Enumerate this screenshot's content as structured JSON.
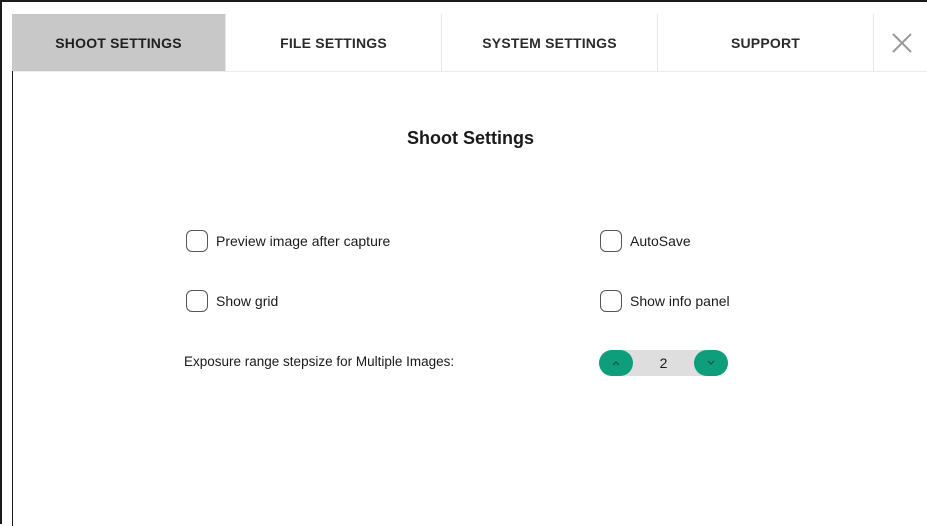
{
  "tabs": [
    {
      "label": "SHOOT SETTINGS",
      "active": true
    },
    {
      "label": "FILE SETTINGS",
      "active": false
    },
    {
      "label": "SYSTEM SETTINGS",
      "active": false
    },
    {
      "label": "SUPPORT",
      "active": false
    }
  ],
  "close_icon": "close-x-icon",
  "page": {
    "title": "Shoot Settings"
  },
  "options": {
    "preview_image": {
      "label": "Preview image after capture",
      "checked": false
    },
    "autosave": {
      "label": "AutoSave",
      "checked": false
    },
    "show_grid": {
      "label": "Show grid",
      "checked": false
    },
    "show_info_panel": {
      "label": "Show info panel",
      "checked": false
    }
  },
  "exposure_stepsize": {
    "label": "Exposure range stepsize for Multiple Images:",
    "value": "2",
    "increase_icon": "chevron-up-icon",
    "decrease_icon": "chevron-down-icon"
  },
  "colors": {
    "accent": "#0e9e7c",
    "active_tab_bg": "#c8c8c8",
    "stepper_track": "#dedede"
  }
}
